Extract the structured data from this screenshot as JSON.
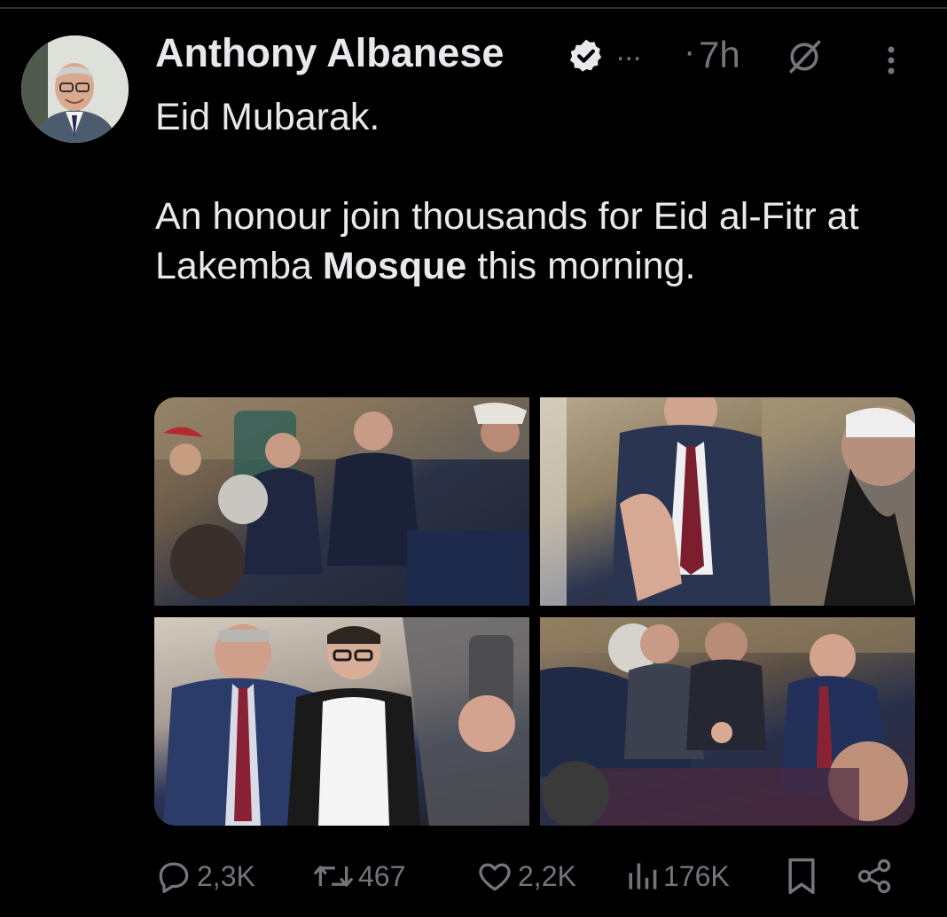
{
  "author": {
    "name": "Anthony Albanese",
    "verified_icon": "verified-badge-icon",
    "truncation": "...",
    "separator": "·",
    "time": "7h"
  },
  "tweet": {
    "line1": "Eid Mubarak.",
    "line2_part1": "An honour join thousands for Eid al-Fitr at Lakemba ",
    "line2_bold": "Mosque",
    "line2_part2": " this morning."
  },
  "media": {
    "count": 4
  },
  "actions": {
    "replies": "2,3K",
    "reposts": "467",
    "likes": "2,2K",
    "views": "176K"
  },
  "colors": {
    "background": "#000000",
    "text_primary": "#e7e9ea",
    "text_secondary": "#71767b"
  }
}
